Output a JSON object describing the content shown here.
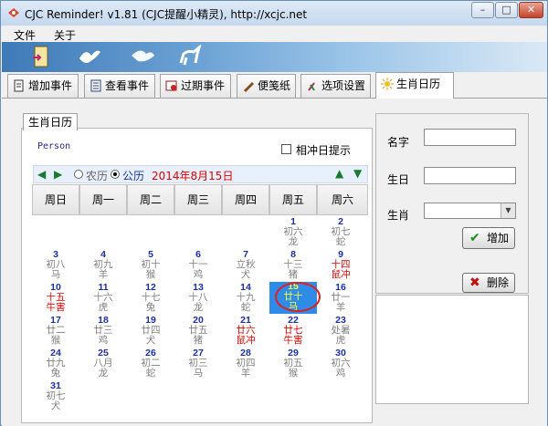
{
  "window": {
    "title": "CJC Reminder! v1.81 (CJC提醒小精灵),  http://xcjc.net"
  },
  "menu": [
    {
      "label": "文件"
    },
    {
      "label": "关于"
    }
  ],
  "tabs": [
    {
      "label": "增加事件",
      "icon": "add-page-icon"
    },
    {
      "label": "查看事件",
      "icon": "list-icon"
    },
    {
      "label": "过期事件",
      "icon": "stamp-icon"
    },
    {
      "label": "便笺纸",
      "icon": "pen-icon"
    },
    {
      "label": "选项设置",
      "icon": "tools-icon"
    },
    {
      "label": "生肖日历",
      "icon": "sun-icon"
    }
  ],
  "subtab": "生肖日历",
  "person": "Person",
  "checkbox_label": "相冲日提示",
  "nav": {
    "lunar": "农历",
    "solar": "公历",
    "date": "2014年8月15日"
  },
  "weekdays": [
    "周日",
    "周一",
    "周二",
    "周三",
    "周四",
    "周五",
    "周六"
  ],
  "days": [
    {
      "n": "1",
      "l1": "初六",
      "l2": "龙"
    },
    {
      "n": "2",
      "l1": "初七",
      "l2": "蛇"
    },
    {
      "n": "3",
      "l1": "初八",
      "l2": "马"
    },
    {
      "n": "4",
      "l1": "初九",
      "l2": "羊"
    },
    {
      "n": "5",
      "l1": "初十",
      "l2": "猴"
    },
    {
      "n": "6",
      "l1": "十一",
      "l2": "鸡"
    },
    {
      "n": "7",
      "l1": "立秋",
      "l2": "犬"
    },
    {
      "n": "8",
      "l1": "十三",
      "l2": "猪"
    },
    {
      "n": "9",
      "l1": "十四",
      "l2": "鼠冲",
      "red": true
    },
    {
      "n": "10",
      "l1": "十五",
      "l2": "牛害",
      "red": true
    },
    {
      "n": "11",
      "l1": "十六",
      "l2": "虎"
    },
    {
      "n": "12",
      "l1": "十七",
      "l2": "兔"
    },
    {
      "n": "13",
      "l1": "十八",
      "l2": "龙"
    },
    {
      "n": "14",
      "l1": "十九",
      "l2": "蛇"
    },
    {
      "n": "15",
      "l1": "廿十",
      "l2": "马",
      "today": true
    },
    {
      "n": "16",
      "l1": "廿一",
      "l2": "羊"
    },
    {
      "n": "17",
      "l1": "廿二",
      "l2": "猴"
    },
    {
      "n": "18",
      "l1": "廿三",
      "l2": "鸡"
    },
    {
      "n": "19",
      "l1": "廿四",
      "l2": "犬"
    },
    {
      "n": "20",
      "l1": "廿五",
      "l2": "猪"
    },
    {
      "n": "21",
      "l1": "廿六",
      "l2": "鼠冲",
      "red": true
    },
    {
      "n": "22",
      "l1": "廿七",
      "l2": "牛害",
      "red": true
    },
    {
      "n": "23",
      "l1": "处暑",
      "l2": "虎"
    },
    {
      "n": "24",
      "l1": "廿九",
      "l2": "兔"
    },
    {
      "n": "25",
      "l1": "八月",
      "l2": "龙"
    },
    {
      "n": "26",
      "l1": "初二",
      "l2": "蛇"
    },
    {
      "n": "27",
      "l1": "初三",
      "l2": "马"
    },
    {
      "n": "28",
      "l1": "初四",
      "l2": "羊"
    },
    {
      "n": "29",
      "l1": "初五",
      "l2": "猴"
    },
    {
      "n": "30",
      "l1": "初六",
      "l2": "鸡"
    },
    {
      "n": "31",
      "l1": "初七",
      "l2": "犬"
    }
  ],
  "form": {
    "name_label": "名字",
    "birthday_label": "生日",
    "zodiac_label": "生肖",
    "add_button": "增加",
    "delete_button": "删除"
  },
  "colors": {
    "today_bg": "#2f8be8",
    "today_text": "#ffff33",
    "clash_red": "#e00000",
    "day_number": "#1a2fb0"
  }
}
